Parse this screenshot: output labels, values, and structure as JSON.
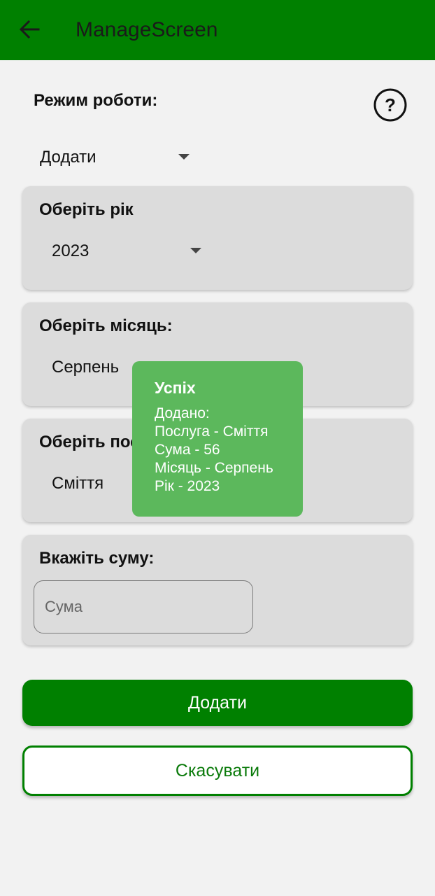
{
  "app_bar": {
    "title": "ManageScreen",
    "back_icon": "arrow-back-icon",
    "background_color": "#008000"
  },
  "mode": {
    "label": "Режим роботи:",
    "help_icon": "help-circle-icon",
    "selected": "Додати"
  },
  "year_card": {
    "title": "Оберіть рік",
    "selected": "2023"
  },
  "month_card": {
    "title": "Оберіть місяць:",
    "selected": "Серпень"
  },
  "service_card": {
    "title": "Оберіть послугу:",
    "selected": "Сміття"
  },
  "sum_card": {
    "title": "Вкажіть суму:",
    "placeholder": "Сума",
    "value": ""
  },
  "buttons": {
    "add_label": "Додати",
    "cancel_label": "Скасувати",
    "primary_color": "#008000"
  },
  "toast": {
    "title": "Успіх",
    "lines": [
      "Додано:",
      "Послуга - Сміття",
      "Сума - 56",
      "Місяць - Серпень",
      "Рік - 2023"
    ],
    "background_color": "#5cb85c"
  }
}
